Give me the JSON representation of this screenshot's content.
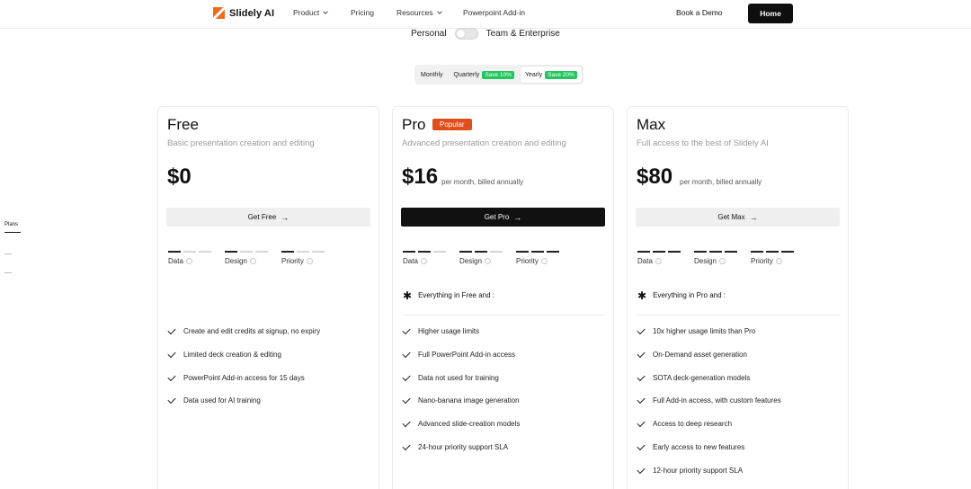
{
  "header": {
    "brand": "Slidely AI",
    "nav": [
      {
        "label": "Product",
        "dropdown": true
      },
      {
        "label": "Pricing",
        "dropdown": false
      },
      {
        "label": "Resources",
        "dropdown": true
      },
      {
        "label": "Powerpoint Add-in",
        "dropdown": false
      }
    ],
    "book_demo": "Book a Demo",
    "home": "Home",
    "brand_color": "#f26a1b"
  },
  "plan_toggle": {
    "left": "Personal",
    "right": "Team & Enterprise",
    "on": false
  },
  "billing": {
    "monthly": "Monthly",
    "quarterly": "Quarterly",
    "quarterly_save": "Save 10%",
    "yearly": "Yearly",
    "yearly_save": "Save 20%",
    "selected": "Yearly",
    "save_color": "#22c55e"
  },
  "side_nav": {
    "active": "Plans"
  },
  "meter_labels": {
    "data": "Data",
    "design": "Design",
    "priority": "Priority"
  },
  "plans": [
    {
      "name": "Free",
      "subtitle": "Basic presentation creation and editing",
      "price": "$0",
      "price_note": "",
      "cta": "Get Free",
      "meters": {
        "data": 1,
        "design": 1,
        "priority": 1
      },
      "inherit": "",
      "features": [
        "Create and edit credits at signup, no expiry",
        "Limited deck creation & editing",
        "PowerPoint Add-in access for 15 days",
        "Data used for AI training"
      ]
    },
    {
      "name": "Pro",
      "badge": "Popular",
      "subtitle": "Advanced presentation creation and editing",
      "price": "$16",
      "price_note": "per month, billed annually",
      "cta": "Get Pro",
      "meters": {
        "data": 2,
        "design": 2,
        "priority": 3
      },
      "inherit": "Everything in Free and :",
      "features": [
        "Higher usage limits",
        "Full PowerPoint Add-in access",
        "Data not used for training",
        "Nano-banana image generation",
        "Advanced slide-creation models",
        "24-hour priority support SLA"
      ]
    },
    {
      "name": "Max",
      "subtitle": "Full access to the best of Slidely AI",
      "price": "$80",
      "price_note": "per month, billed annually",
      "cta": "Get Max",
      "meters": {
        "data": 3,
        "design": 3,
        "priority": 3
      },
      "inherit": "Everything in Pro and :",
      "features": [
        "10x higher usage limits than Pro",
        "On-Demand asset generation",
        "SOTA deck-generation models",
        "Full Add-in access, with custom features",
        "Access to deep research",
        "Early access to new features",
        "12-hour priority support SLA"
      ]
    }
  ]
}
